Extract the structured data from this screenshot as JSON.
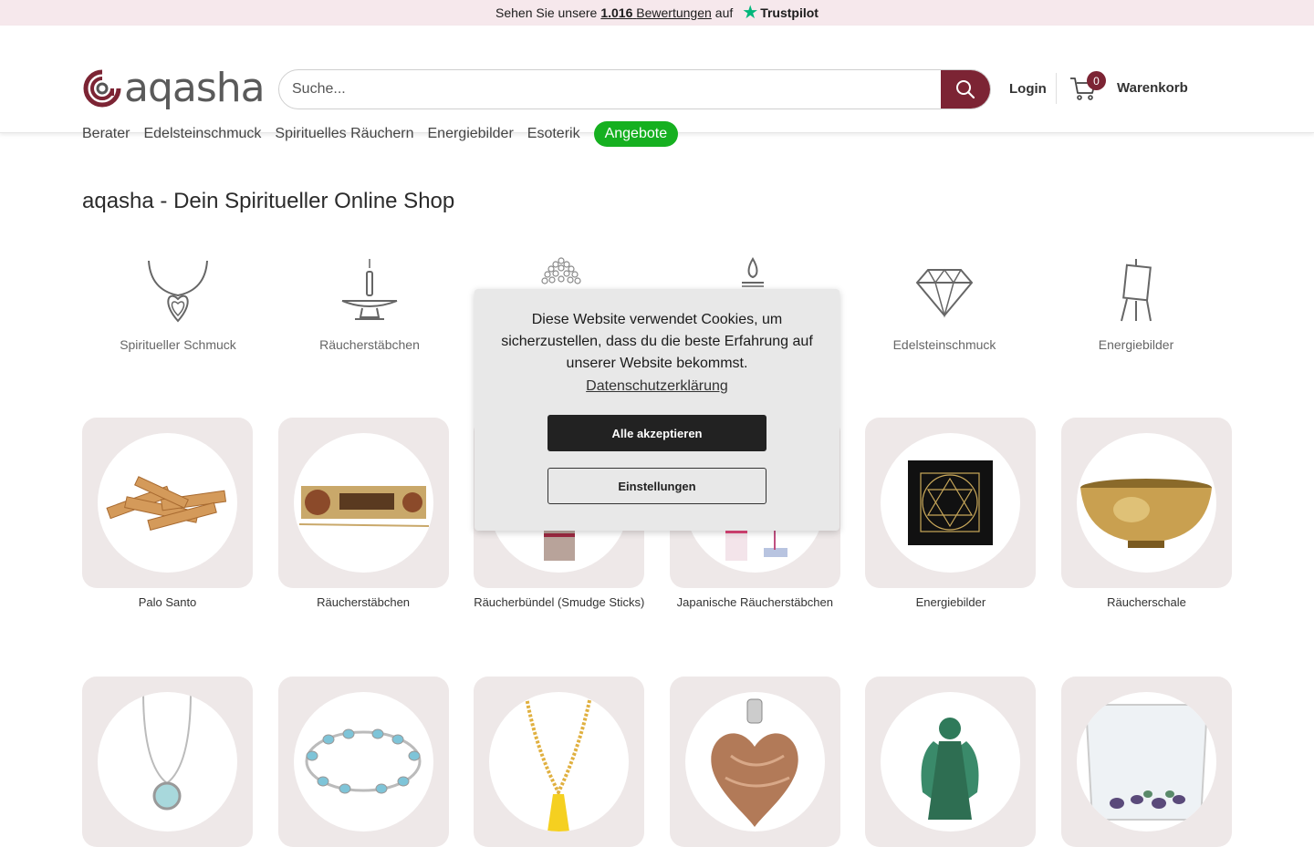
{
  "trustbar": {
    "prefix": "Sehen Sie unsere",
    "count": "1.016",
    "link_text": "Bewertungen",
    "suffix": "auf",
    "brand": "Trustpilot",
    "star_color": "#00b67a"
  },
  "header": {
    "logo_text": "aqasha",
    "search_placeholder": "Suche...",
    "login_label": "Login",
    "cart_count": "0",
    "cart_label": "Warenkorb",
    "accent_color": "#7c2434"
  },
  "nav": {
    "items": [
      "Berater",
      "Edelsteinschmuck",
      "Spirituelles Räuchern",
      "Energiebilder",
      "Esoterik"
    ],
    "promo": "Angebote",
    "promo_color": "#16b020"
  },
  "main": {
    "title": "aqasha - Dein Spiritueller Online Shop",
    "category_icons": [
      {
        "label": "Spiritueller Schmuck",
        "icon": "heart-pendant-icon"
      },
      {
        "label": "Räucherstäbchen",
        "icon": "incense-holder-icon"
      },
      {
        "label": "",
        "icon": "mala-beads-icon"
      },
      {
        "label": "",
        "icon": "candle-icon"
      },
      {
        "label": "Edelsteinschmuck",
        "icon": "diamond-icon"
      },
      {
        "label": "Energiebilder",
        "icon": "easel-icon"
      }
    ],
    "tiles_row1": [
      {
        "label": "Palo Santo"
      },
      {
        "label": "Räucherstäbchen"
      },
      {
        "label": "Räucherbündel (Smudge Sticks)"
      },
      {
        "label": "Japanische Räucherstäbchen"
      },
      {
        "label": "Energiebilder"
      },
      {
        "label": "Räucherschale"
      }
    ],
    "tiles_row2": [
      {
        "image": "pendant-necklace"
      },
      {
        "image": "gemstone-bracelet"
      },
      {
        "image": "mala-necklace"
      },
      {
        "image": "heart-pendant"
      },
      {
        "image": "angel-figure"
      },
      {
        "image": "gemstone-water-glass"
      }
    ]
  },
  "cookie": {
    "message": "Diese Website verwendet Cookies, um sicherzustellen, dass du die beste Erfahrung auf unserer Website bekommst.",
    "privacy_link": "Datenschutzerklärung",
    "accept_label": "Alle akzeptieren",
    "settings_label": "Einstellungen"
  }
}
